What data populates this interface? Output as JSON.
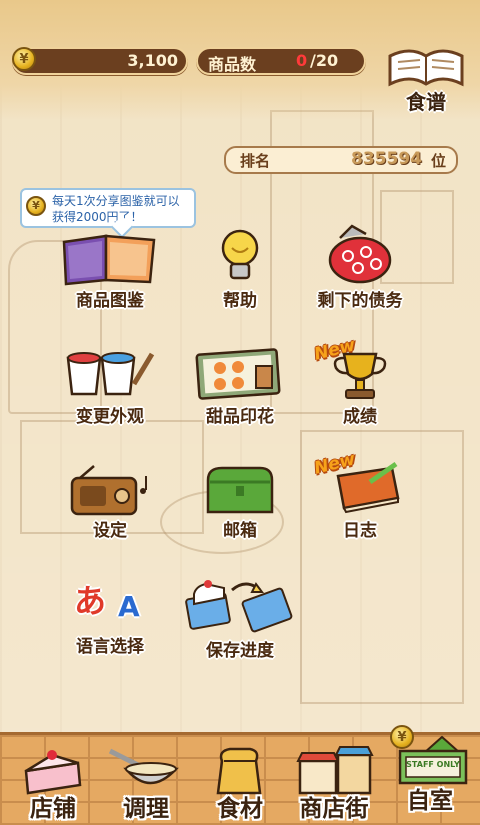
{
  "header": {
    "money": "3,100",
    "goods_label": "商品数",
    "goods_count": "0",
    "goods_max": "/20",
    "recipe_label": "食谱"
  },
  "rank": {
    "label": "排名",
    "value": "835594",
    "unit": "位"
  },
  "tooltip": {
    "text": "每天1次分享图鉴就可以获得2000円了！"
  },
  "menu": [
    {
      "label": "商品图鉴",
      "icon": "book-icon"
    },
    {
      "label": "帮助",
      "icon": "lightbulb-icon"
    },
    {
      "label": "剩下的债务",
      "icon": "coin-purse-icon"
    },
    {
      "label": "变更外观",
      "icon": "paint-bucket-icon"
    },
    {
      "label": "甜品印花",
      "icon": "stamp-card-icon"
    },
    {
      "label": "成绩",
      "icon": "trophy-icon",
      "badge": "New"
    },
    {
      "label": "设定",
      "icon": "radio-icon"
    },
    {
      "label": "邮箱",
      "icon": "mailbox-icon"
    },
    {
      "label": "日志",
      "icon": "diary-icon",
      "badge": "New"
    },
    {
      "label": "语言选择",
      "icon": "language-icon",
      "glyph_a": "あ",
      "glyph_b": "A"
    },
    {
      "label": "保存进度",
      "icon": "save-transfer-icon"
    }
  ],
  "bottom_nav": [
    {
      "label": "店铺",
      "icon": "cake-icon"
    },
    {
      "label": "调理",
      "icon": "mixing-bowl-icon"
    },
    {
      "label": "食材",
      "icon": "flour-sack-icon"
    },
    {
      "label": "商店街",
      "icon": "shop-street-icon"
    },
    {
      "label": "自室",
      "icon": "staff-only-icon",
      "sign": "STAFF ONLY"
    }
  ],
  "colors": {
    "brown": "#6b3f1f",
    "accent_red": "#e02020",
    "tooltip_blue": "#2c63a8"
  }
}
